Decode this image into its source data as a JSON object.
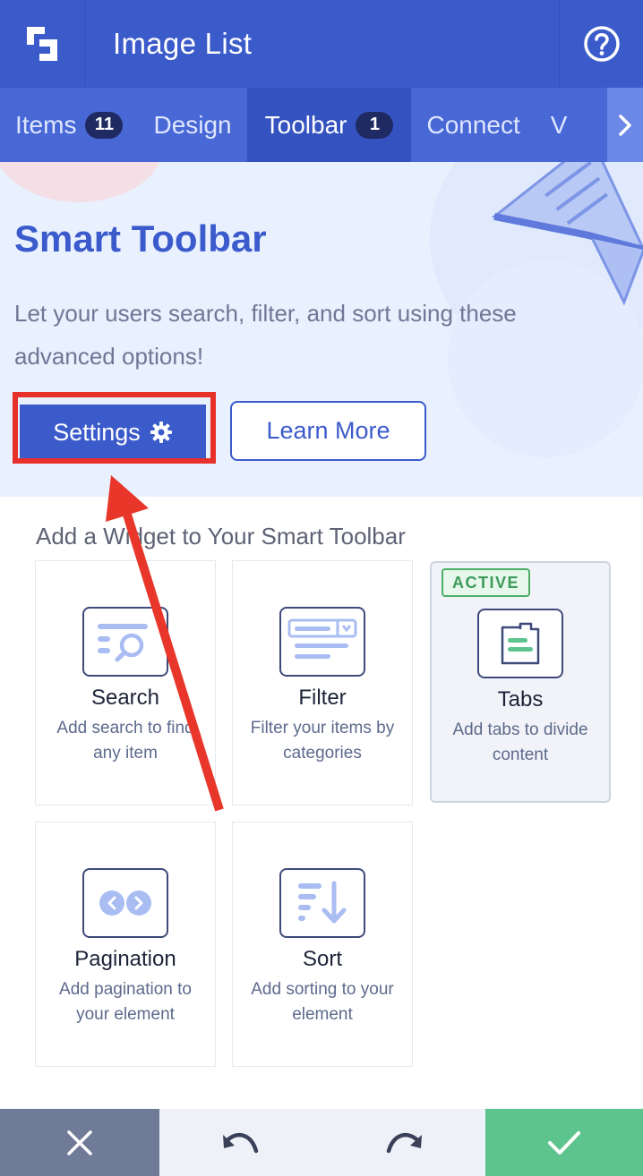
{
  "header": {
    "title": "Image List"
  },
  "tabs": [
    {
      "label": "Items",
      "badge": "11"
    },
    {
      "label": "Design"
    },
    {
      "label": "Toolbar",
      "badge": "1"
    },
    {
      "label": "Connect"
    },
    {
      "label": "V"
    }
  ],
  "hero": {
    "title": "Smart Toolbar",
    "description": "Let your users search, filter, and sort using these advanced options!",
    "settings_label": "Settings",
    "learn_more_label": "Learn More"
  },
  "widgets": {
    "section_title": "Add a Widget to Your Smart Toolbar",
    "items": [
      {
        "title": "Search",
        "desc": "Add search to find any item"
      },
      {
        "title": "Filter",
        "desc": "Filter your items by categories"
      },
      {
        "title": "Tabs",
        "desc": "Add tabs to divide content",
        "badge": "ACTIVE"
      },
      {
        "title": "Pagination",
        "desc": "Add pagination to your element"
      },
      {
        "title": "Sort",
        "desc": "Add sorting to your element"
      }
    ]
  },
  "colors": {
    "brand": "#3c5bcb",
    "annotation": "#e8302a",
    "confirm": "#5ec48e",
    "cancel": "#707b98"
  }
}
